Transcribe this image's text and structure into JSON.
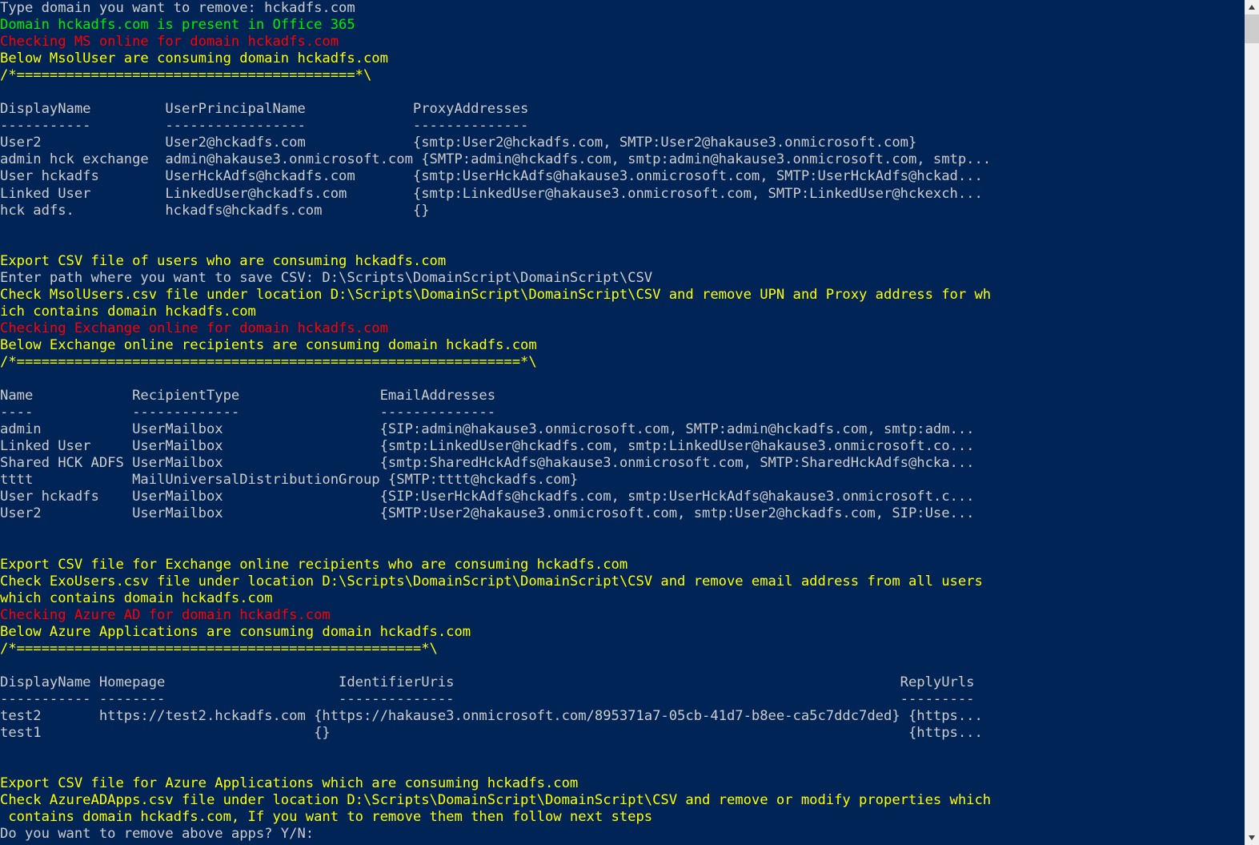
{
  "window": {
    "app": "Windows PowerShell",
    "background_color": "#012456",
    "foreground_color": "#cccccc",
    "green_color": "#00ee00",
    "red_color": "#ff0000",
    "yellow_color": "#ffff00"
  },
  "scrollbar": {
    "up_arrow_icon": "triangle-up-icon",
    "down_arrow_icon": "triangle-down-icon",
    "thumb_label": "scrollbar-thumb"
  },
  "console": {
    "lines": [
      {
        "id": "l00",
        "color": "white",
        "text": "Type domain you want to remove: hckadfs.com"
      },
      {
        "id": "l01",
        "color": "green",
        "text": "Domain hckadfs.com is present in Office 365"
      },
      {
        "id": "l02",
        "color": "red",
        "text": "Checking MS online for domain hckadfs.com"
      },
      {
        "id": "l03",
        "color": "yellow",
        "text": "Below MsolUser are consuming domain hckadfs.com"
      },
      {
        "id": "l04",
        "color": "yellow",
        "text": "/*=========================================*\\"
      },
      {
        "id": "l05",
        "color": "white",
        "text": ""
      },
      {
        "id": "l06",
        "color": "white",
        "text": "DisplayName         UserPrincipalName             ProxyAddresses"
      },
      {
        "id": "l07",
        "color": "white",
        "text": "-----------         -----------------             --------------"
      },
      {
        "id": "l08",
        "color": "white",
        "text": "User2               User2@hckadfs.com             {smtp:User2@hckadfs.com, SMTP:User2@hakause3.onmicrosoft.com}"
      },
      {
        "id": "l09",
        "color": "white",
        "text": "admin hck exchange  admin@hakause3.onmicrosoft.com {SMTP:admin@hckadfs.com, smtp:admin@hakause3.onmicrosoft.com, smtp..."
      },
      {
        "id": "l10",
        "color": "white",
        "text": "User hckadfs        UserHckAdfs@hckadfs.com       {smtp:UserHckAdfs@hakause3.onmicrosoft.com, SMTP:UserHckAdfs@hckad..."
      },
      {
        "id": "l11",
        "color": "white",
        "text": "Linked User         LinkedUser@hckadfs.com        {smtp:LinkedUser@hakause3.onmicrosoft.com, SMTP:LinkedUser@hckexch..."
      },
      {
        "id": "l12",
        "color": "white",
        "text": "hck adfs.           hckadfs@hckadfs.com           {}"
      },
      {
        "id": "l13",
        "color": "white",
        "text": ""
      },
      {
        "id": "l14",
        "color": "white",
        "text": ""
      },
      {
        "id": "l15",
        "color": "yellow",
        "text": "Export CSV file of users who are consuming hckadfs.com"
      },
      {
        "id": "l16",
        "color": "white",
        "text": "Enter path where you want to save CSV: D:\\Scripts\\DomainScript\\DomainScript\\CSV"
      },
      {
        "id": "l17",
        "color": "yellow",
        "text": "Check MsolUsers.csv file under location D:\\Scripts\\DomainScript\\DomainScript\\CSV and remove UPN and Proxy address for wh"
      },
      {
        "id": "l18",
        "color": "yellow",
        "text": "ich contains domain hckadfs.com"
      },
      {
        "id": "l19",
        "color": "red",
        "text": "Checking Exchange online for domain hckadfs.com"
      },
      {
        "id": "l20",
        "color": "yellow",
        "text": "Below Exchange online recipients are consuming domain hckadfs.com"
      },
      {
        "id": "l21",
        "color": "yellow",
        "text": "/*=============================================================*\\"
      },
      {
        "id": "l22",
        "color": "white",
        "text": ""
      },
      {
        "id": "l23",
        "color": "white",
        "text": "Name            RecipientType                 EmailAddresses"
      },
      {
        "id": "l24",
        "color": "white",
        "text": "----            -------------                 --------------"
      },
      {
        "id": "l25",
        "color": "white",
        "text": "admin           UserMailbox                   {SIP:admin@hakause3.onmicrosoft.com, SMTP:admin@hckadfs.com, smtp:adm..."
      },
      {
        "id": "l26",
        "color": "white",
        "text": "Linked User     UserMailbox                   {smtp:LinkedUser@hckadfs.com, smtp:LinkedUser@hakause3.onmicrosoft.co..."
      },
      {
        "id": "l27",
        "color": "white",
        "text": "Shared HCK ADFS UserMailbox                   {smtp:SharedHckAdfs@hakause3.onmicrosoft.com, SMTP:SharedHckAdfs@hcka..."
      },
      {
        "id": "l28",
        "color": "white",
        "text": "tttt            MailUniversalDistributionGroup {SMTP:tttt@hckadfs.com}"
      },
      {
        "id": "l29",
        "color": "white",
        "text": "User hckadfs    UserMailbox                   {SIP:UserHckAdfs@hckadfs.com, smtp:UserHckAdfs@hakause3.onmicrosoft.c..."
      },
      {
        "id": "l30",
        "color": "white",
        "text": "User2           UserMailbox                   {SMTP:User2@hakause3.onmicrosoft.com, smtp:User2@hckadfs.com, SIP:Use..."
      },
      {
        "id": "l31",
        "color": "white",
        "text": ""
      },
      {
        "id": "l32",
        "color": "white",
        "text": ""
      },
      {
        "id": "l33",
        "color": "yellow",
        "text": "Export CSV file for Exchange online recipients who are consuming hckadfs.com"
      },
      {
        "id": "l34",
        "color": "yellow",
        "text": "Check ExoUsers.csv file under location D:\\Scripts\\DomainScript\\DomainScript\\CSV and remove email address from all users"
      },
      {
        "id": "l35",
        "color": "yellow",
        "text": "which contains domain hckadfs.com"
      },
      {
        "id": "l36",
        "color": "red",
        "text": "Checking Azure AD for domain hckadfs.com"
      },
      {
        "id": "l37",
        "color": "yellow",
        "text": "Below Azure Applications are consuming domain hckadfs.com"
      },
      {
        "id": "l38",
        "color": "yellow",
        "text": "/*=================================================*\\"
      },
      {
        "id": "l39",
        "color": "white",
        "text": ""
      },
      {
        "id": "l40",
        "color": "white",
        "text": "DisplayName Homepage                     IdentifierUris                                                      ReplyUrls"
      },
      {
        "id": "l41",
        "color": "white",
        "text": "----------- --------                     --------------                                                      ---------"
      },
      {
        "id": "l42",
        "color": "white",
        "text": "test2       https://test2.hckadfs.com {https://hakause3.onmicrosoft.com/895371a7-05cb-41d7-b8ee-ca5c7ddc7ded} {https..."
      },
      {
        "id": "l43",
        "color": "white",
        "text": "test1                                 {}                                                                      {https..."
      },
      {
        "id": "l44",
        "color": "white",
        "text": ""
      },
      {
        "id": "l45",
        "color": "white",
        "text": ""
      },
      {
        "id": "l46",
        "color": "yellow",
        "text": "Export CSV file for Azure Applications which are consuming hckadfs.com"
      },
      {
        "id": "l47",
        "color": "yellow",
        "text": "Check AzureADApps.csv file under location D:\\Scripts\\DomainScript\\DomainScript\\CSV and remove or modify properties which"
      },
      {
        "id": "l48",
        "color": "yellow",
        "text": " contains domain hckadfs.com, If you want to remove them then follow next steps"
      },
      {
        "id": "l49",
        "color": "white",
        "text": "Do you want to remove above apps? Y/N:"
      }
    ]
  }
}
